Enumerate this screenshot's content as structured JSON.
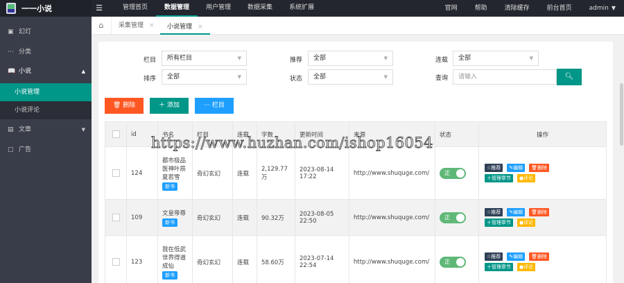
{
  "app": {
    "title": "一一小说"
  },
  "topnav": {
    "items": [
      "管理首页",
      "数据管理",
      "用户管理",
      "数据采集",
      "系统扩展"
    ],
    "active": "数据管理"
  },
  "topright": {
    "items": [
      "官网",
      "帮助",
      "清除缓存",
      "前台首页"
    ],
    "user": "admin"
  },
  "sidebar": {
    "items": [
      {
        "icon": "image-icon",
        "label": "幻灯"
      },
      {
        "icon": "dots-icon",
        "label": "分类"
      },
      {
        "icon": "book-icon",
        "label": "小说"
      },
      {
        "icon": "doc-icon",
        "label": "文章"
      },
      {
        "icon": "ad-icon",
        "label": "广告"
      }
    ],
    "sub": [
      "小说管理",
      "小说评论"
    ]
  },
  "tabs": [
    "采集管理",
    "小说管理"
  ],
  "filters": {
    "column_label": "栏目",
    "column_value": "所有栏目",
    "recommend_label": "推荐",
    "recommend_value": "全部",
    "serial_label": "连载",
    "serial_value": "全部",
    "sort_label": "排序",
    "sort_value": "全部",
    "status_label": "状态",
    "status_value": "全部",
    "query_label": "查询",
    "query_placeholder": "请输入"
  },
  "actions": {
    "delete": "删除",
    "add": "添加",
    "column": "栏目"
  },
  "table": {
    "headers": [
      "id",
      "书名",
      "栏目",
      "连载",
      "字数",
      "更新时间",
      "来源",
      "状态",
      "操作"
    ],
    "rows": [
      {
        "id": "124",
        "name": "都市极品医神叶辰夏若雪",
        "badge": "新书",
        "column": "奇幻玄幻",
        "serial": "连载",
        "words": "2,129.77万",
        "updated": "2023-08-14 17:22",
        "source": "http://www.shuquge.com/",
        "status": "正"
      },
      {
        "id": "109",
        "name": "文皇帝尊",
        "badge": "新书",
        "column": "奇幻玄幻",
        "serial": "连载",
        "words": "90.32万",
        "updated": "2023-08-05 22:50",
        "source": "http://www.shuquge.com/",
        "status": "正"
      },
      {
        "id": "123",
        "name": "我在低武世界得道成仙",
        "badge": "新书",
        "column": "奇幻玄幻",
        "serial": "连载",
        "words": "58.60万",
        "updated": "2023-07-14 22:54",
        "source": "http://www.shuquge.com/",
        "status": "正"
      }
    ],
    "ops": {
      "recommend": "推荐",
      "edit": "编辑",
      "delete": "删除",
      "chapters": "管理章节",
      "comments": "评论"
    }
  },
  "watermark": "https://www.huzhan.com/ishop16054"
}
